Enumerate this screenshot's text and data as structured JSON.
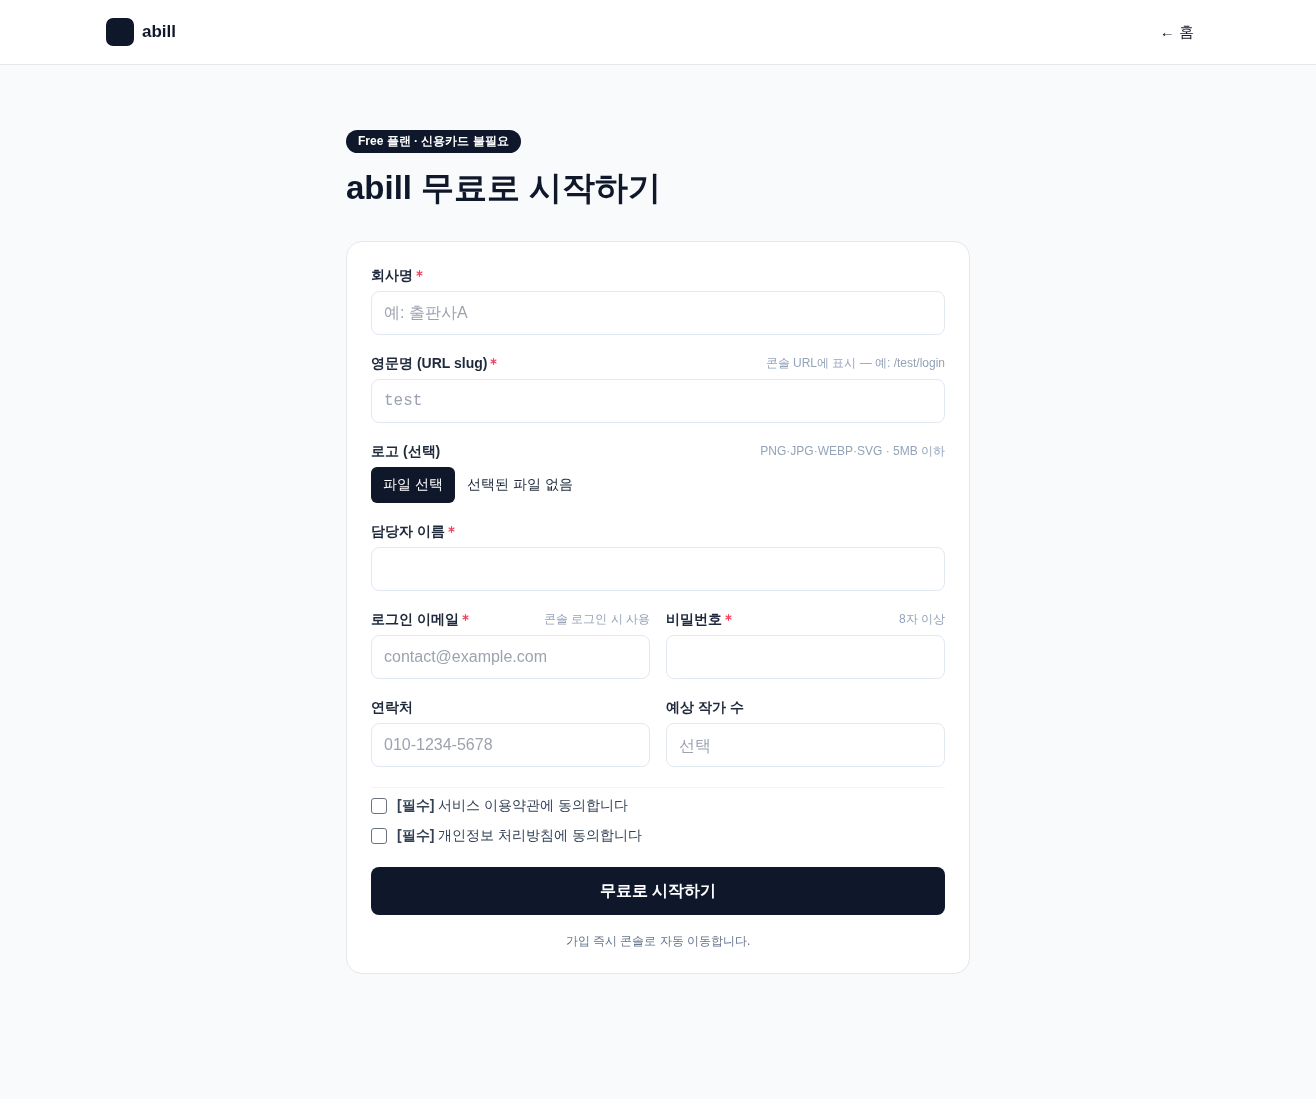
{
  "header": {
    "logo_text": "abill",
    "home_link": "← 홈"
  },
  "hero": {
    "badge": "Free 플랜 · 신용카드 불필요",
    "title": "abill 무료로 시작하기"
  },
  "form": {
    "rows": [
      [
        {
          "kind": "text",
          "label": "회사명",
          "required": true,
          "placeholder": "예: 출판사A"
        }
      ],
      [
        {
          "kind": "slug",
          "label": "영문명 (URL slug)",
          "required": true,
          "hint": "콘솔 URL에 표시 — 예: /test/login",
          "placeholder": "test"
        }
      ],
      [
        {
          "kind": "file",
          "label": "로고 (선택)",
          "required": false,
          "hint": "PNG·JPG·WEBP·SVG · 5MB 이하",
          "button": "파일 선택",
          "status": "선택된 파일 없음"
        }
      ],
      [
        {
          "kind": "text",
          "label": "담당자 이름",
          "required": true
        }
      ],
      [
        {
          "kind": "text",
          "label": "로그인 이메일",
          "required": true,
          "hint": "콘솔 로그인 시 사용",
          "placeholder": "contact@example.com"
        },
        {
          "kind": "password",
          "label": "비밀번호",
          "required": true,
          "hint": "8자 이상"
        }
      ],
      [
        {
          "kind": "text",
          "label": "연락처",
          "required": false,
          "placeholder": "010-1234-5678"
        },
        {
          "kind": "select",
          "label": "예상 작가 수",
          "required": false,
          "placeholder": "선택"
        }
      ]
    ],
    "agreements": [
      {
        "text": "**[필수]** 서비스 이용약관에 동의합니다",
        "checked": false
      },
      {
        "text": "**[필수]** 개인정보 처리방침에 동의합니다",
        "checked": false
      }
    ],
    "submit": "무료로 시작하기",
    "note": "가입 즉시 콘솔로 자동 이동합니다."
  }
}
